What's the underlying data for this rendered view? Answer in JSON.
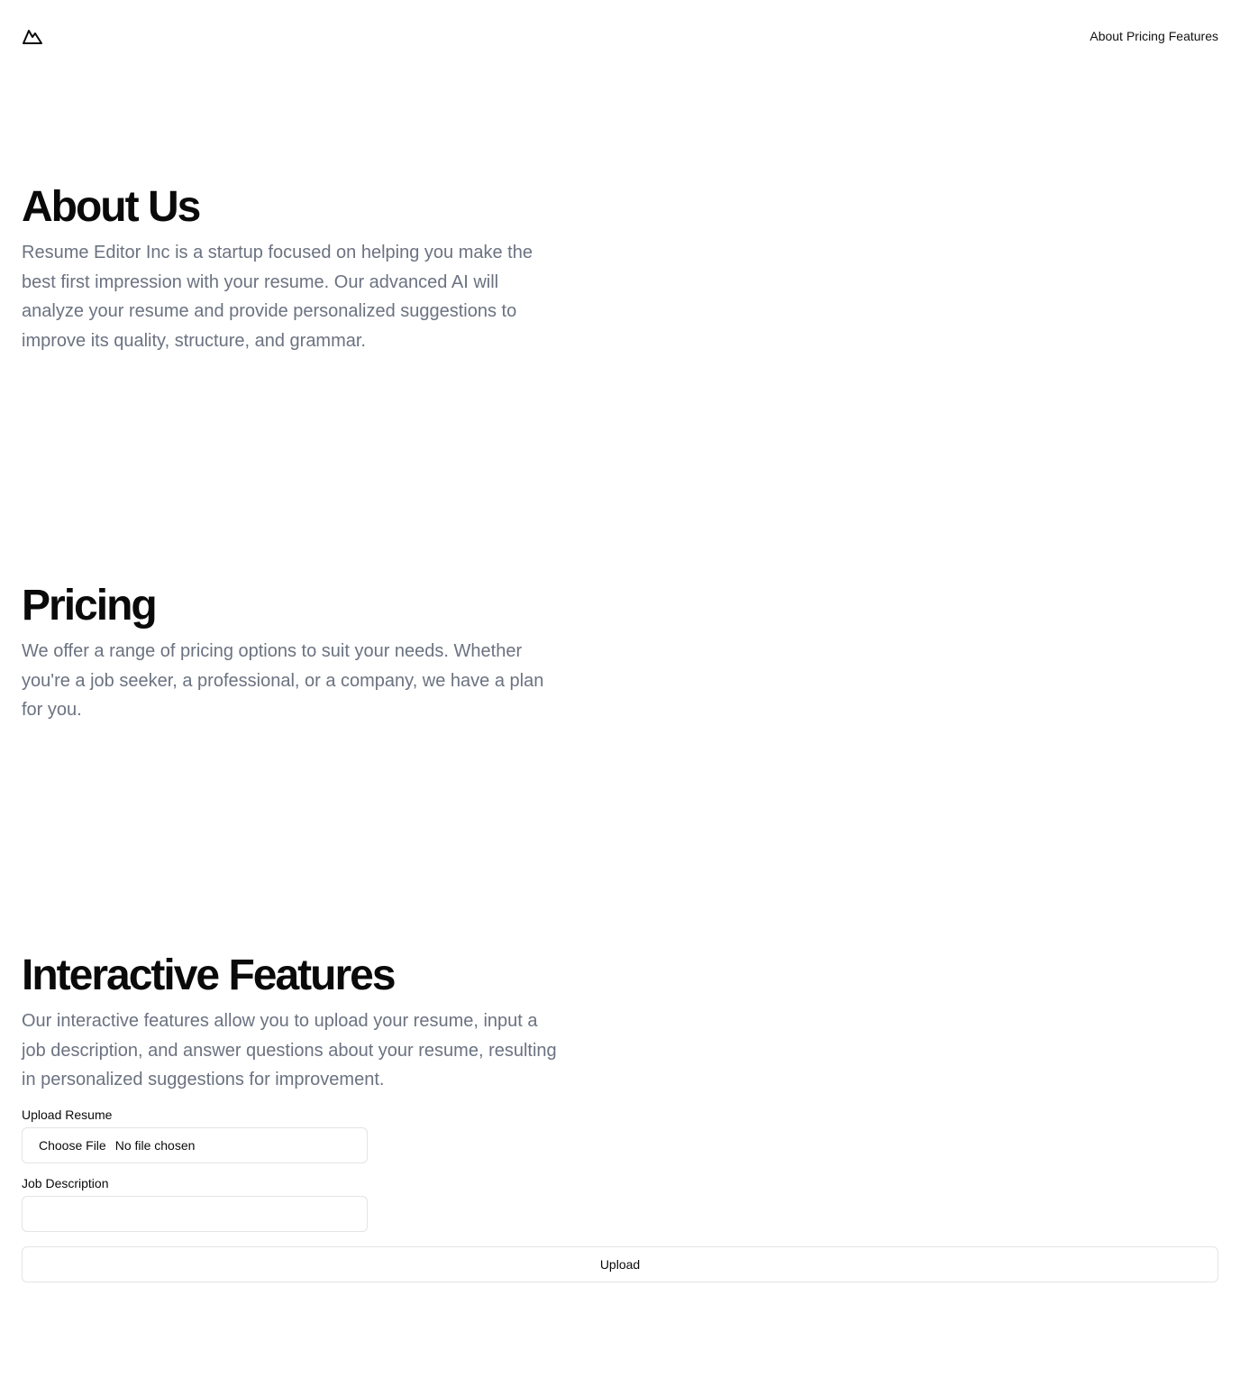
{
  "header": {
    "logo_icon": "mountain-icon",
    "nav": {
      "about": "About",
      "pricing": "Pricing",
      "features": "Features"
    }
  },
  "about": {
    "title": "About Us",
    "body": "Resume Editor Inc is a startup focused on helping you make the best first impression with your resume. Our advanced AI will analyze your resume and provide personalized suggestions to improve its quality, structure, and grammar."
  },
  "pricing": {
    "title": "Pricing",
    "body": "We offer a range of pricing options to suit your needs. Whether you're a job seeker, a professional, or a company, we have a plan for you."
  },
  "features": {
    "title": "Interactive Features",
    "body": "Our interactive features allow you to upload your resume, input a job description, and answer questions about your resume, resulting in personalized suggestions for improvement."
  },
  "form": {
    "upload_label": "Upload Resume",
    "choose_file": "Choose File",
    "file_status": "No file chosen",
    "job_description_label": "Job Description",
    "job_description_value": "",
    "upload_button": "Upload"
  }
}
